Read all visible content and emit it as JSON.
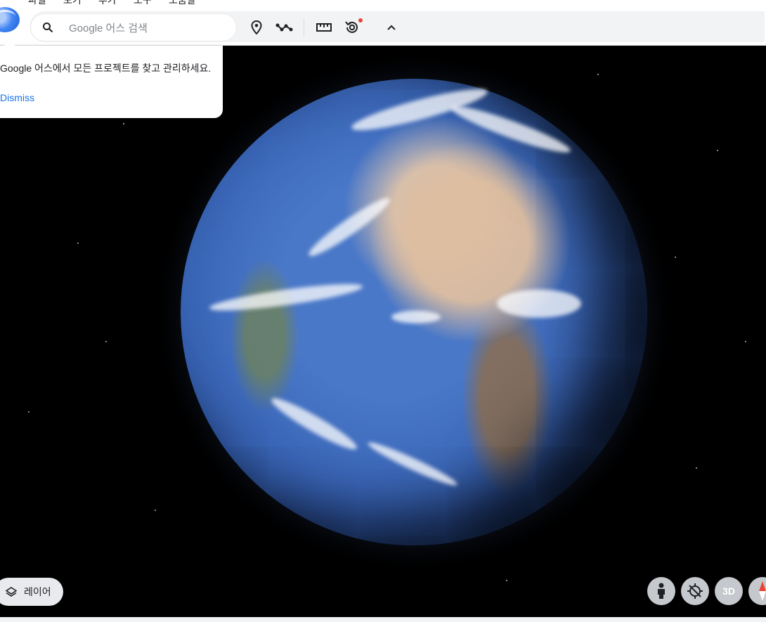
{
  "menu": {
    "items": [
      "파일",
      "보기",
      "추가",
      "도구",
      "도움말"
    ]
  },
  "search": {
    "placeholder": "Google 어스 검색",
    "value": ""
  },
  "toolbar": {
    "icons": [
      "place-marker-icon",
      "path-icon",
      "ruler-icon",
      "history-icon",
      "collapse-icon"
    ]
  },
  "popup": {
    "message": "Google 어스에서 모든 프로젝트를 찾고 관리하세요.",
    "dismiss_label": "Dismiss"
  },
  "layers": {
    "label": "레이어"
  },
  "controls": {
    "three_d_label": "3D"
  },
  "colors": {
    "accent": "#1a73e8",
    "notification": "#ea4335",
    "space": "#000000"
  }
}
